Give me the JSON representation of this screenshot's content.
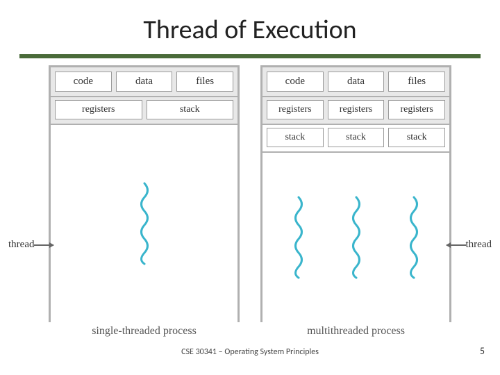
{
  "slide": {
    "title": "Thread of Execution",
    "footer": "CSE 30341 – Operating System Principles",
    "page_number": "5"
  },
  "shared": {
    "code": "code",
    "data": "data",
    "files": "files",
    "registers": "registers",
    "stack": "stack",
    "thread": "thread"
  },
  "captions": {
    "single": "single-threaded process",
    "multi": "multithreaded process"
  }
}
